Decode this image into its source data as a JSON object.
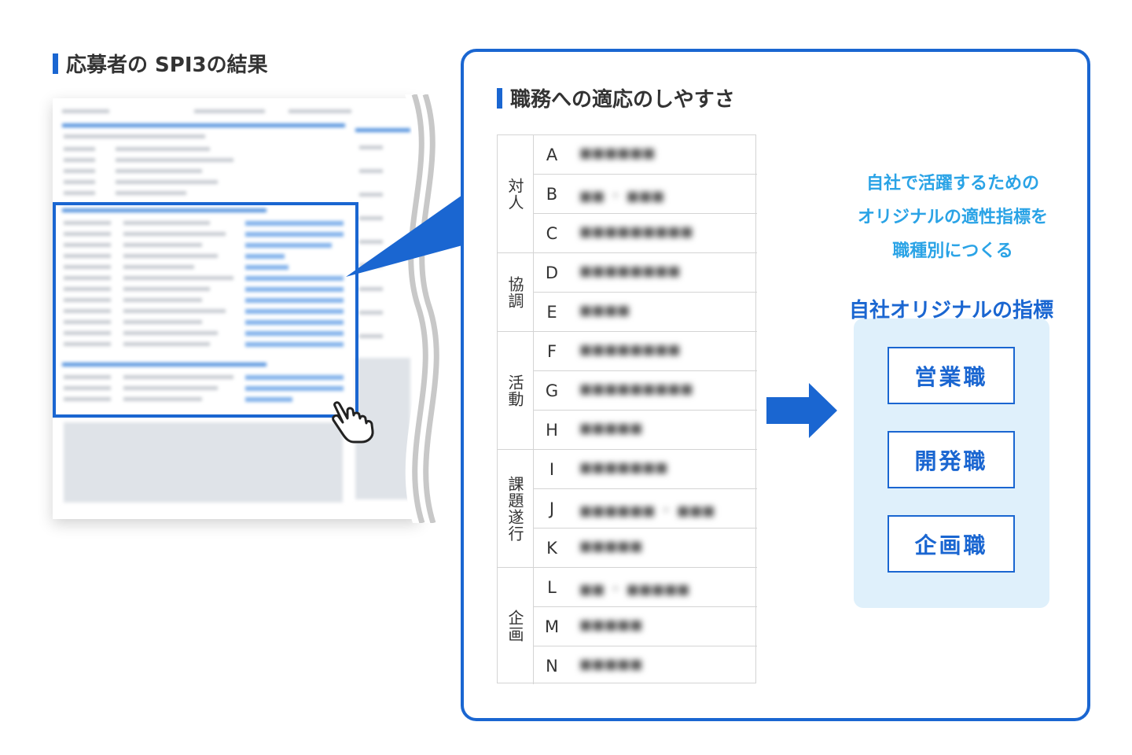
{
  "left_heading": "応募者の SPI3の結果",
  "inner_heading": "職務への適応のしやすさ",
  "table": {
    "groups": [
      {
        "label": "対人",
        "rows": [
          "A",
          "B",
          "C"
        ]
      },
      {
        "label": "協調",
        "rows": [
          "D",
          "E"
        ]
      },
      {
        "label": "活動",
        "rows": [
          "F",
          "G",
          "H"
        ]
      },
      {
        "label": "課題遂行",
        "rows": [
          "I",
          "J",
          "K"
        ]
      },
      {
        "label": "企画",
        "rows": [
          "L",
          "M",
          "N"
        ]
      }
    ]
  },
  "tagline": [
    "自社で活躍するための",
    "オリジナルの適性指標を",
    "職種別につくる"
  ],
  "original_index_title": "自社オリジナルの指標",
  "jobs": [
    "営業職",
    "開発職",
    "企画職"
  ],
  "colors": {
    "accent": "#1a66d1",
    "tagline": "#2aa3e6",
    "panel": "#dff0fb"
  },
  "icons": [
    "pointer-hand-icon",
    "right-arrow-icon"
  ]
}
